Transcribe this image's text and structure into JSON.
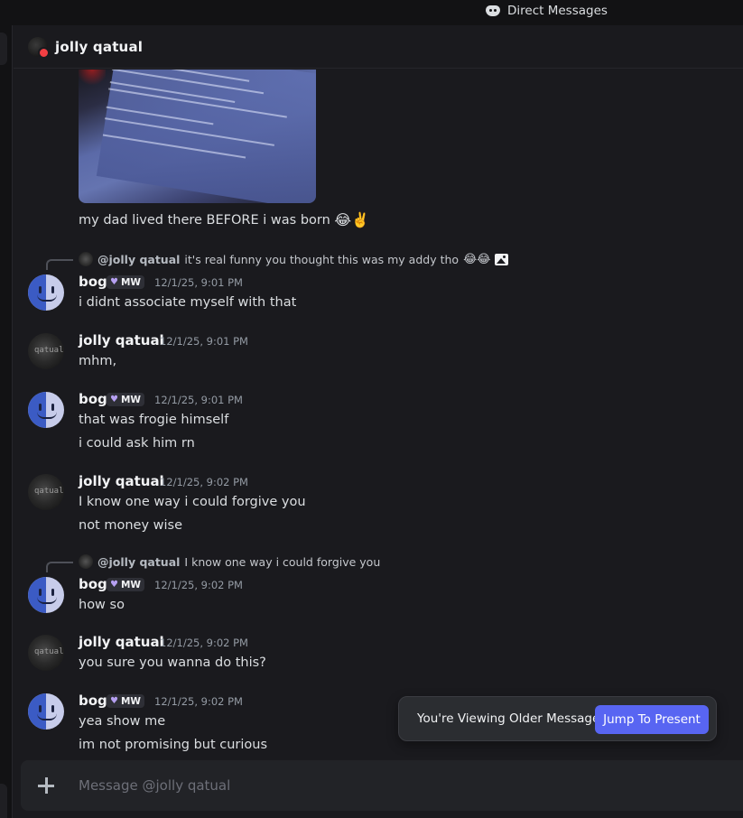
{
  "titlebar": {
    "title": "Direct Messages",
    "icon": "discord-icon"
  },
  "header": {
    "name": "jolly qatual"
  },
  "top_message": {
    "text": "my dad lived there BEFORE i was born",
    "emojis": "😂✌️"
  },
  "messages": [
    {
      "reply": {
        "author": "@jolly qatual",
        "text": "it's real funny you thought this was my addy tho",
        "emojis": "😂😂"
      },
      "author": "bog",
      "tag": "MW",
      "time": "12/1/25, 9:01 PM",
      "lines": [
        "i didnt associate myself with that"
      ]
    },
    {
      "author": "jolly qatual",
      "time": "12/1/25, 9:01 PM",
      "lines": [
        "mhm,"
      ]
    },
    {
      "author": "bog",
      "tag": "MW",
      "time": "12/1/25, 9:01 PM",
      "lines": [
        "that was frogie himself",
        "i could ask him rn"
      ]
    },
    {
      "author": "jolly qatual",
      "time": "12/1/25, 9:02 PM",
      "lines": [
        "I know one way i could forgive you",
        "not money wise"
      ]
    },
    {
      "reply": {
        "author": "@jolly qatual",
        "text": "I know one way i could forgive you"
      },
      "author": "bog",
      "tag": "MW",
      "time": "12/1/25, 9:02 PM",
      "lines": [
        "how so"
      ]
    },
    {
      "author": "jolly qatual",
      "time": "12/1/25, 9:02 PM",
      "lines": [
        "you sure you wanna do this?"
      ]
    },
    {
      "author": "bog",
      "tag": "MW",
      "time": "12/1/25, 9:02 PM",
      "lines": [
        "yea show me",
        "im not promising but curious"
      ]
    }
  ],
  "banner": {
    "text": "You're Viewing Older Messages",
    "button": "Jump To Present"
  },
  "composer": {
    "placeholder": "Message @jolly qatual"
  },
  "colors": {
    "accent": "#5865f2",
    "background": "#1a1a1e",
    "tag_heart": "#b6a0f2"
  }
}
